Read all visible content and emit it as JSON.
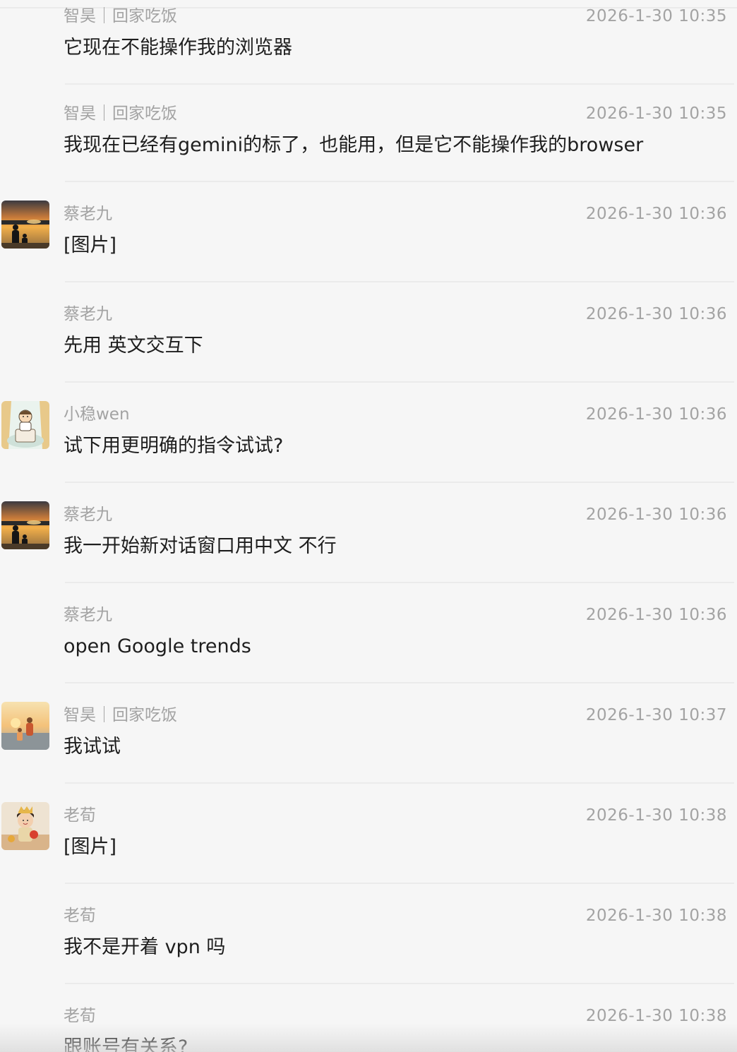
{
  "messages": [
    {
      "sender": "智昊｜回家吃饭",
      "time": "2026-1-30 10:35",
      "text": "它现在不能操作我的浏览器"
    },
    {
      "sender": "智昊｜回家吃饭",
      "time": "2026-1-30 10:35",
      "text": "我现在已经有gemini的标了，也能用，但是它不能操作我的browser"
    },
    {
      "sender": "蔡老九",
      "time": "2026-1-30 10:36",
      "text": "[图片]"
    },
    {
      "sender": "蔡老九",
      "time": "2026-1-30 10:36",
      "text": "先用 英文交互下"
    },
    {
      "sender": "小稳wen",
      "time": "2026-1-30 10:36",
      "text": "试下用更明确的指令试试?"
    },
    {
      "sender": "蔡老九",
      "time": "2026-1-30 10:36",
      "text": "我一开始新对话窗口用中文 不行"
    },
    {
      "sender": "蔡老九",
      "time": "2026-1-30 10:36",
      "text": "open Google trends"
    },
    {
      "sender": "智昊｜回家吃饭",
      "time": "2026-1-30 10:37",
      "text": "我试试"
    },
    {
      "sender": "老荀",
      "time": "2026-1-30 10:38",
      "text": "[图片]"
    },
    {
      "sender": "老荀",
      "time": "2026-1-30 10:38",
      "text": "我不是开着 vpn 吗"
    },
    {
      "sender": "老荀",
      "time": "2026-1-30 10:38",
      "text": "跟账号有关系?"
    }
  ]
}
